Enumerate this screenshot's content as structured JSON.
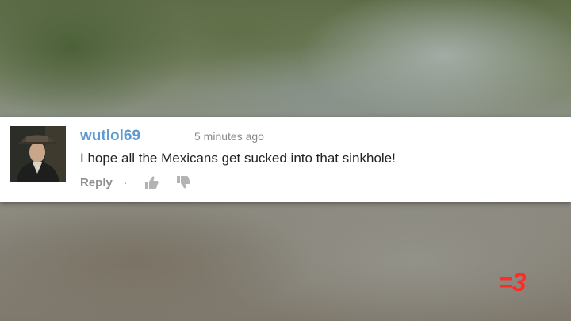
{
  "comment": {
    "username": "wutlol69",
    "timestamp": "5 minutes ago",
    "text": "I hope all the Mexicans get sucked into that sinkhole!",
    "reply_label": "Reply",
    "separator": "·",
    "icons": {
      "like": "thumbs-up-icon",
      "dislike": "thumbs-down-icon"
    }
  },
  "watermark": {
    "text": "=3",
    "color": "#ff2a2a"
  },
  "colors": {
    "username": "#5e9ad3",
    "card_background": "#ffffff",
    "muted_text": "#8f8f8f"
  }
}
